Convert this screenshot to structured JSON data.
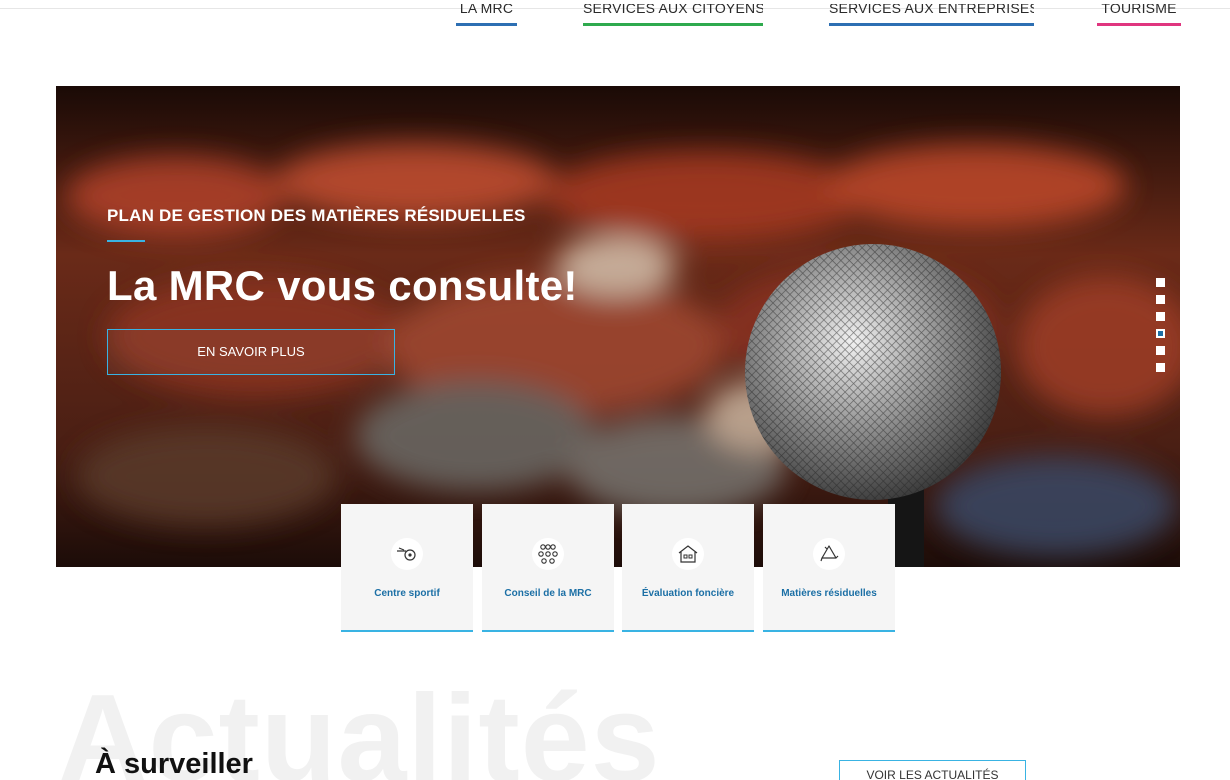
{
  "nav": {
    "items": [
      {
        "label": "LA MRC"
      },
      {
        "label": "SERVICES AUX CITOYENS"
      },
      {
        "label": "SERVICES AUX ENTREPRISES"
      },
      {
        "label": "TOURISME"
      }
    ]
  },
  "hero": {
    "kicker": "PLAN DE GESTION DES MATIÈRES RÉSIDUELLES",
    "title": "La MRC vous consulte!",
    "button_label": "EN SAVOIR PLUS",
    "slide_count": 6,
    "active_slide": 4,
    "image": "microphone-in-front-of-blurred-audience"
  },
  "cards": [
    {
      "label": "Centre sportif",
      "icon": "whistle-icon"
    },
    {
      "label": "Conseil de la MRC",
      "icon": "people-group-icon"
    },
    {
      "label": "Évaluation foncière",
      "icon": "house-icon"
    },
    {
      "label": "Matières résiduelles",
      "icon": "recycle-icon"
    }
  ],
  "news": {
    "watermark": "Actualités",
    "title": "À surveiller",
    "button_label": "VOIR LES ACTUALITÉS"
  },
  "colors": {
    "accent": "#39b3e3",
    "link": "#1b6fa5",
    "nav_blue": "#2d6fb3",
    "nav_green": "#2faa4e",
    "nav_pink": "#e0357f"
  }
}
